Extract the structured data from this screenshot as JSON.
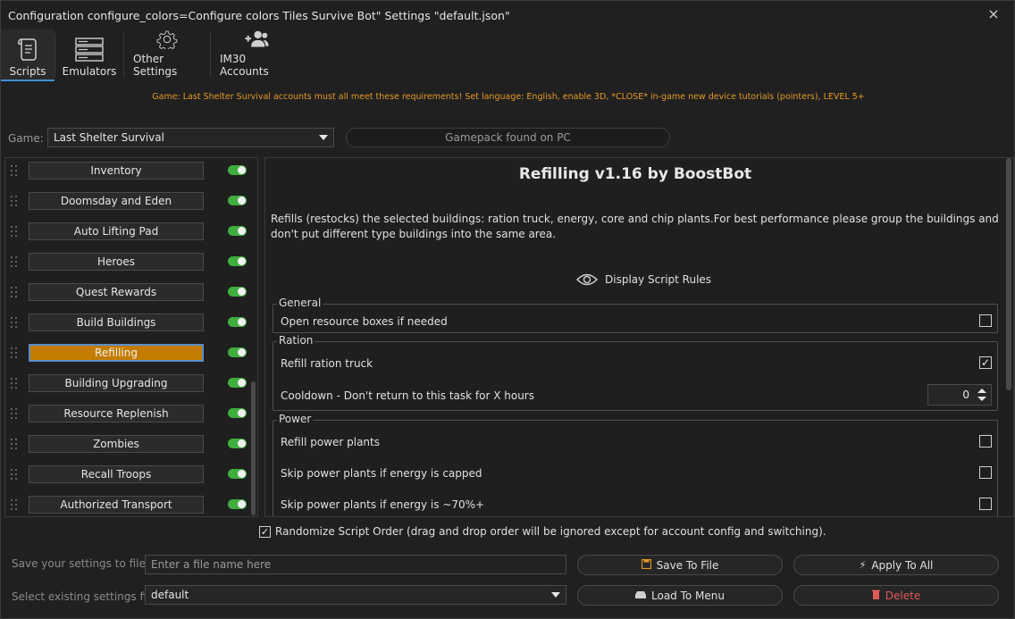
{
  "window": {
    "title": "Configuration configure_colors=Configure colors Tiles Survive Bot\" Settings \"default.json\"",
    "close_icon": "×"
  },
  "toolbar": {
    "tabs": [
      {
        "label": "Scripts",
        "icon": "scroll-icon"
      },
      {
        "label": "Emulators",
        "icon": "server-icon"
      },
      {
        "label": "Other Settings",
        "icon": "gear-icon"
      },
      {
        "label": "IM30 Accounts",
        "icon": "users-add-icon"
      }
    ]
  },
  "notice": "Game: Last Shelter Survival accounts must all meet these requirements! Set language: English, enable 3D, *CLOSE* in-game new device tutorials (pointers), LEVEL 5+",
  "game": {
    "label": "Game:",
    "selected": "Last Shelter Survival",
    "gamepack_status": "Gamepack found on PC"
  },
  "scripts": [
    {
      "label": "Inventory",
      "enabled": true,
      "active": false
    },
    {
      "label": "Doomsday and Eden",
      "enabled": true,
      "active": false
    },
    {
      "label": "Auto Lifting Pad",
      "enabled": true,
      "active": false
    },
    {
      "label": "Heroes",
      "enabled": true,
      "active": false
    },
    {
      "label": "Quest Rewards",
      "enabled": true,
      "active": false
    },
    {
      "label": "Build Buildings",
      "enabled": true,
      "active": false
    },
    {
      "label": "Refilling",
      "enabled": true,
      "active": true
    },
    {
      "label": "Building Upgrading",
      "enabled": true,
      "active": false
    },
    {
      "label": "Resource Replenish",
      "enabled": true,
      "active": false
    },
    {
      "label": "Zombies",
      "enabled": true,
      "active": false
    },
    {
      "label": "Recall Troops",
      "enabled": true,
      "active": false
    },
    {
      "label": "Authorized Transport",
      "enabled": true,
      "active": false
    }
  ],
  "script_detail": {
    "title": "Refilling v1.16 by BoostBot",
    "description": "Refills (restocks) the selected buildings: ration truck, energy, core and chip plants.For best performance please group the buildings and don't put different type buildings into the same area.",
    "rules_label": "Display Script Rules",
    "groups": {
      "general": {
        "label": "General",
        "options": [
          {
            "label": "Open resource boxes if needed",
            "checked": false
          }
        ]
      },
      "ration": {
        "label": "Ration",
        "options": [
          {
            "label": "Refill ration truck",
            "checked": true
          }
        ],
        "cooldown_label": "Cooldown - Don't return to this task for X hours",
        "cooldown_value": "0"
      },
      "power": {
        "label": "Power",
        "options": [
          {
            "label": "Refill power plants",
            "checked": false
          },
          {
            "label": "Skip power plants if energy is capped",
            "checked": false
          },
          {
            "label": "Skip power plants if energy is ~70%+",
            "checked": false
          }
        ]
      }
    }
  },
  "randomize": {
    "checked": true,
    "label": "Randomize Script Order (drag and drop order will be ignored except for account config and switching)."
  },
  "save": {
    "label": "Save your settings to file",
    "placeholder": "Enter a file name here",
    "save_button": "Save To File",
    "apply_button": "Apply To All"
  },
  "load": {
    "label": "Select existing settings file",
    "selected": "default",
    "load_button": "Load To Menu",
    "delete_button": "Delete"
  },
  "colors": {
    "accent": "#3b8fd8",
    "active_script": "#c47c00",
    "toggle_on": "#3fae3f",
    "notice": "#e39a2a",
    "delete": "#e05a5a"
  }
}
